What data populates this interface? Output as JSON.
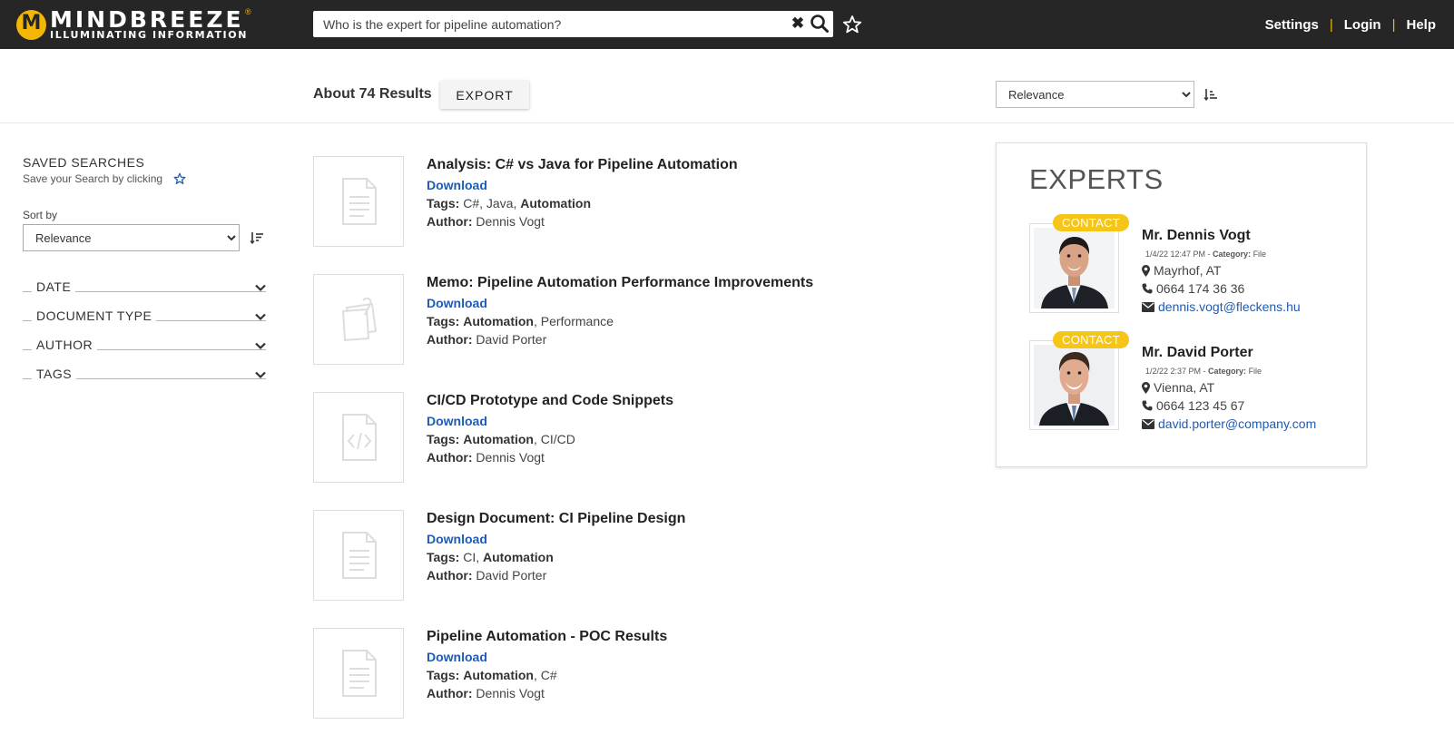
{
  "app": {
    "logo_title": "MINDBREEZE",
    "logo_subtitle": "ILLUMINATING INFORMATION",
    "logo_registered": "®"
  },
  "search": {
    "query": "Who is the expert for pipeline automation?"
  },
  "topnav": {
    "settings": "Settings",
    "login": "Login",
    "help": "Help",
    "separator": "|"
  },
  "results_header": {
    "count_text": "About 74 Results",
    "export_label": "EXPORT",
    "sort_value": "Relevance"
  },
  "sidebar": {
    "saved_title": "SAVED SEARCHES",
    "saved_hint": "Save your Search by clicking",
    "sortby_label": "Sort by",
    "sort_value": "Relevance",
    "facets": [
      "DATE",
      "DOCUMENT TYPE",
      "AUTHOR",
      "TAGS"
    ]
  },
  "results": [
    {
      "title": "Analysis: C# vs Java for Pipeline Automation",
      "download": "Download",
      "tags_label": "Tags:",
      "tags_plain": " C#, Java, ",
      "tags_bold": "Automation",
      "tags_tail": "",
      "author_label": "Author:",
      "author": " Dennis Vogt",
      "icon": "document-icon"
    },
    {
      "title": "Memo: Pipeline Automation Performance Improvements",
      "download": "Download",
      "tags_label": "Tags:",
      "tags_plain": " ",
      "tags_bold": "Automation",
      "tags_tail": ", Performance",
      "author_label": "Author:",
      "author": " David Porter",
      "icon": "memo-icon"
    },
    {
      "title": "CI/CD Prototype and Code Snippets",
      "download": "Download",
      "tags_label": "Tags:",
      "tags_plain": " ",
      "tags_bold": "Automation",
      "tags_tail": ", CI/CD",
      "author_label": "Author:",
      "author": " Dennis Vogt",
      "icon": "code-file-icon"
    },
    {
      "title": "Design Document: CI Pipeline Design",
      "download": "Download",
      "tags_label": "Tags:",
      "tags_plain": " CI, ",
      "tags_bold": "Automation",
      "tags_tail": "",
      "author_label": "Author:",
      "author": " David Porter",
      "icon": "document-icon"
    },
    {
      "title": "Pipeline Automation - POC Results",
      "download": "Download",
      "tags_label": "Tags:",
      "tags_plain": " ",
      "tags_bold": "Automation",
      "tags_tail": ", C#",
      "author_label": "Author:",
      "author": " Dennis Vogt",
      "icon": "document-icon"
    }
  ],
  "experts": {
    "title": "EXPERTS",
    "items": [
      {
        "contact": "CONTACT",
        "name": "Mr. Dennis Vogt",
        "date": "1/4/22 12:47 PM - ",
        "category_label": "Category:",
        "category": " File",
        "location": "Mayrhof, AT",
        "phone": "0664 174 36 36",
        "email": "dennis.vogt@fleckens.hu"
      },
      {
        "contact": "CONTACT",
        "name": "Mr. David Porter",
        "date": "1/2/22 2:37 PM - ",
        "category_label": "Category:",
        "category": " File",
        "location": "Vienna, AT",
        "phone": "0664 123 45 67",
        "email": "david.porter@company.com"
      }
    ]
  },
  "colors": {
    "topbar": "#262626",
    "accent_yellow": "#f2b705",
    "link_blue": "#1f5bb5"
  }
}
